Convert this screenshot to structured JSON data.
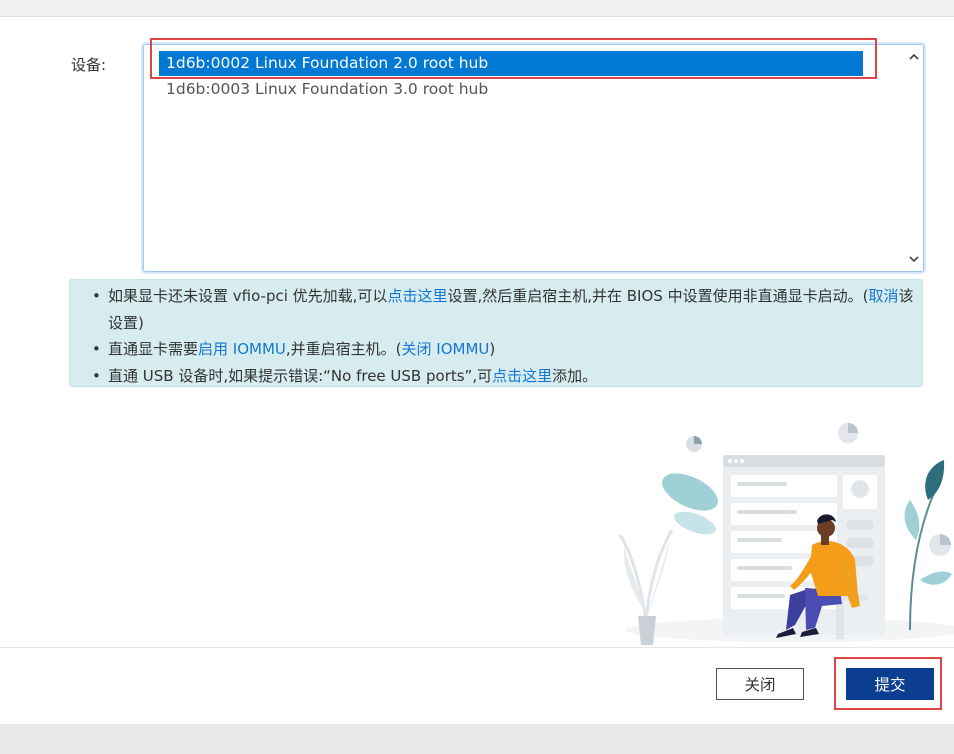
{
  "form": {
    "device_label": "设备:",
    "devices": [
      {
        "label": "1d6b:0002 Linux Foundation 2.0 root hub",
        "selected": true
      },
      {
        "label": "1d6b:0003 Linux Foundation 3.0 root hub",
        "selected": false
      }
    ]
  },
  "notice": {
    "item1": {
      "t1": "如果显卡还未设置 vfio-pci 优先加载,可以",
      "link1": "点击这里",
      "t2": "设置,然后重启宿主机,并在 BIOS 中设置使用非直通显卡启动。(",
      "link2": "取消",
      "t3": "该设置)"
    },
    "item2": {
      "t1": "直通显卡需要",
      "link1": "启用 IOMMU",
      "t2": ",并重启宿主机。(",
      "link2": "关闭 IOMMU",
      "t3": ")"
    },
    "item3": {
      "t1": "直通 USB 设备时,如果提示错误:“No free USB ports”,可",
      "link1": "点击这里",
      "t2": "添加。"
    }
  },
  "footer": {
    "close_label": "关闭",
    "submit_label": "提交"
  },
  "colors": {
    "selection": "#0078d4",
    "notice_bg": "#d6ecef",
    "link": "#1677d2",
    "submit_bg": "#0b3d91",
    "highlight": "#e04545"
  },
  "icons": {
    "scroll_up": "chevron-up-icon",
    "scroll_down": "chevron-down-icon"
  }
}
